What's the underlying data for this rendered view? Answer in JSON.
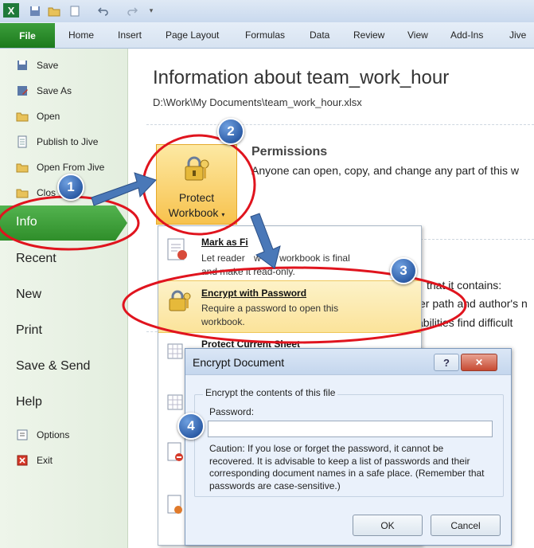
{
  "ribbon": {
    "file_label": "File",
    "tabs": [
      "Home",
      "Insert",
      "Page Layout",
      "Formulas",
      "Data",
      "Review",
      "View",
      "Add-Ins",
      "Jive"
    ]
  },
  "nav": {
    "small_top": [
      "Save",
      "Save As",
      "Open",
      "Publish to Jive",
      "Open From Jive",
      "Clos"
    ],
    "active": "Info",
    "big": [
      "Recent",
      "New",
      "Print",
      "Save & Send",
      "Help"
    ],
    "small_bottom": [
      "Options",
      "Exit"
    ]
  },
  "main": {
    "title": "Information about team_work_hour",
    "path": "D:\\Work\\My Documents\\team_work_hour.xlsx",
    "permissions_heading": "Permissions",
    "permissions_text": "Anyone can open, copy, and change any part of this w",
    "protect_label_1": "Protect",
    "protect_label_2": "Workbook",
    "behind_line1": "that it contains:",
    "behind_line2": "er path and author's n",
    "behind_line3": "abilities find difficult"
  },
  "menu": {
    "mark_title": "Mark as Fi",
    "mark_desc_1": "Let reader",
    "mark_desc_1b": "w the workbook is final",
    "mark_desc_2": "and make it read-only.",
    "encrypt_title": "Encrypt with Password",
    "encrypt_desc": "Require a password to open this workbook.",
    "protect_sheet_title": "Protect Current Sheet"
  },
  "dialog": {
    "title": "Encrypt Document",
    "help_glyph": "?",
    "close_glyph": "✕",
    "group_label": "Encrypt the contents of this file",
    "password_label": "Password:",
    "password_value": "",
    "caution": "Caution: If you lose or forget the password, it cannot be recovered. It is advisable to keep a list of passwords and their corresponding document names in a safe place. (Remember that passwords are case-sensitive.)",
    "ok": "OK",
    "cancel": "Cancel"
  },
  "callouts": [
    "1",
    "2",
    "3",
    "4"
  ],
  "colors": {
    "file_green": "#2a8a2a",
    "info_green": "#3aa035",
    "highlight": "#fbe9a6",
    "annotation_red": "#e0141e",
    "arrow_blue": "#4a78b8"
  }
}
